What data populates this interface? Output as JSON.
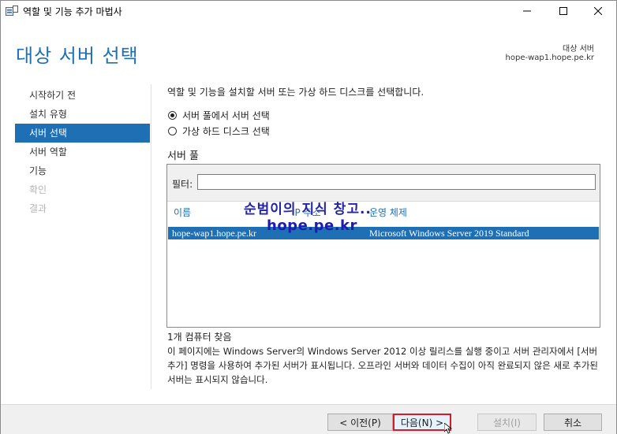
{
  "window": {
    "title": "역할 및 기능 추가 마법사"
  },
  "header": {
    "title": "대상 서버 선택",
    "destination_label": "대상 서버",
    "destination_value": "hope-wap1.hope.pe.kr"
  },
  "nav": {
    "items": [
      {
        "label": "시작하기 전",
        "state": "normal"
      },
      {
        "label": "설치 유형",
        "state": "normal"
      },
      {
        "label": "서버 선택",
        "state": "active"
      },
      {
        "label": "서버 역할",
        "state": "normal"
      },
      {
        "label": "기능",
        "state": "normal"
      },
      {
        "label": "확인",
        "state": "disabled"
      },
      {
        "label": "결과",
        "state": "disabled"
      }
    ]
  },
  "content": {
    "intro": "역할 및 기능을 설치할 서버 또는 가상 하드 디스크를 선택합니다.",
    "options": [
      {
        "label": "서버 풀에서 서버 선택",
        "checked": true
      },
      {
        "label": "가상 하드 디스크 선택",
        "checked": false
      }
    ],
    "pool_title": "서버 풀",
    "filter_label": "필터:",
    "filter_value": "",
    "columns": [
      "이름",
      "IP 주소",
      "운영 체제"
    ],
    "rows": [
      {
        "name": "hope-wap1.hope.pe.kr",
        "ip": "",
        "os": "Microsoft Windows Server 2019 Standard",
        "selected": true
      }
    ],
    "count_text": "1개 컴퓨터 찾음",
    "description": "이 페이지에는 Windows Server의 Windows Server 2012 이상 릴리스를 실행 중이고 서버 관리자에서 [서버 추가] 명령을 사용하여 추가된 서버가 표시됩니다. 오프라인 서버와 데이터 수집이 아직 완료되지 않은 새로 추가된 서버는 표시되지 않습니다."
  },
  "watermark": {
    "line1": "순범이의 지식 창고..",
    "line2": "hope.pe.kr"
  },
  "buttons": {
    "previous": "< 이전(P)",
    "next": "다음(N) >",
    "install": "설치(I)",
    "cancel": "취소"
  },
  "colors": {
    "accent": "#1f6fb5",
    "highlight_border": "#d81b2a"
  }
}
